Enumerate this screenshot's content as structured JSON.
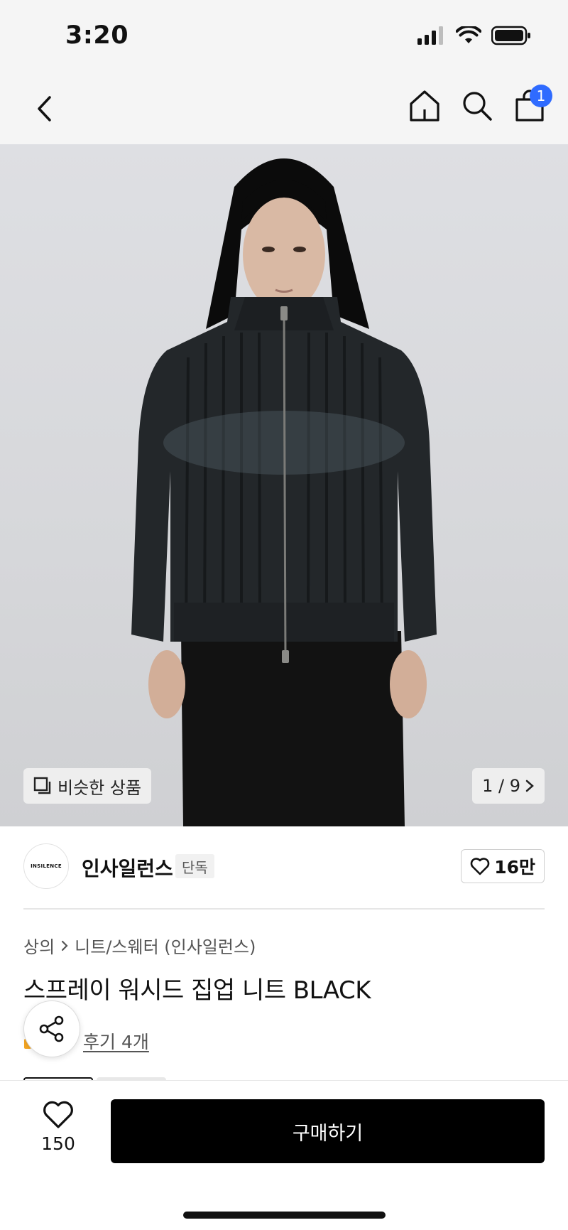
{
  "status": {
    "time": "3:20"
  },
  "nav": {
    "cart_count": "1"
  },
  "hero": {
    "similar_label": "비슷한 상품",
    "page_counter": "1 / 9"
  },
  "brand": {
    "logo_text": "INSILENCE",
    "name": "인사일런스",
    "tag": "단독",
    "likes": "16만"
  },
  "breadcrumb": {
    "category": "상의",
    "subcategory": "니트/스웨터 (인사일런스)"
  },
  "product": {
    "title": "스프레이 워시드 집업 니트 BLACK",
    "reviews": "후기 4개"
  },
  "bottom": {
    "wish_count": "150",
    "buy_label": "구매하기"
  },
  "colors": {
    "badge": "#2f6bff",
    "buy_button": "#000000"
  }
}
